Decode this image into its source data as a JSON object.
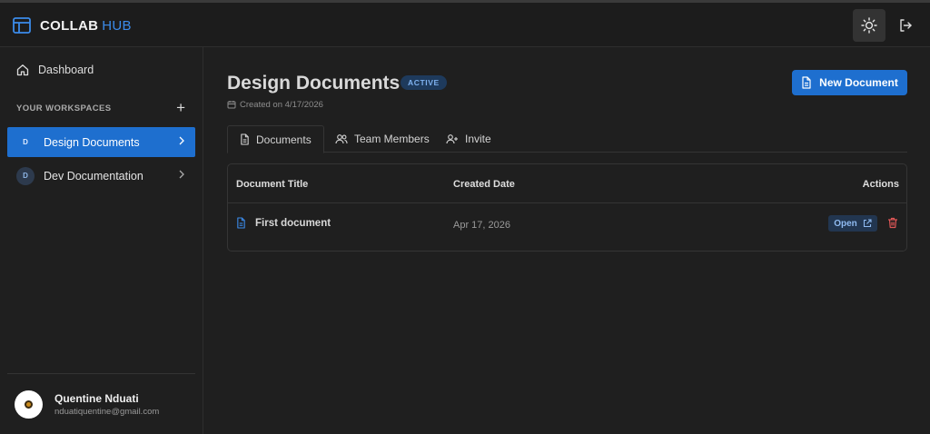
{
  "app": {
    "brand_primary": "COLLAB",
    "brand_secondary": "HUB"
  },
  "colors": {
    "accent": "#1e6fcf",
    "danger": "#e05757",
    "background": "#1f1f1f"
  },
  "header": {
    "theme_icon": "sun-icon",
    "logout_icon": "logout-icon"
  },
  "sidebar": {
    "dashboard_label": "Dashboard",
    "workspaces_label": "YOUR WORKSPACES",
    "add_icon": "plus-icon",
    "items": [
      {
        "initial": "D",
        "label": "Design Documents",
        "active": true
      },
      {
        "initial": "D",
        "label": "Dev Documentation",
        "active": false
      }
    ],
    "user": {
      "name": "Quentine Nduati",
      "email": "nduatiquentine@gmail.com"
    }
  },
  "main": {
    "title": "Design Documents",
    "status": "ACTIVE",
    "created": "Created on 4/17/2026",
    "new_button": "New Document",
    "tabs": [
      {
        "label": "Documents",
        "icon": "document-icon",
        "active": true
      },
      {
        "label": "Team Members",
        "icon": "users-icon",
        "active": false
      },
      {
        "label": "Invite",
        "icon": "user-plus-icon",
        "active": false
      }
    ],
    "table": {
      "columns": [
        "Document Title",
        "Created Date",
        "Actions"
      ],
      "rows": [
        {
          "title": "First document",
          "date": "Apr 17, 2026",
          "open_label": "Open"
        }
      ]
    }
  }
}
